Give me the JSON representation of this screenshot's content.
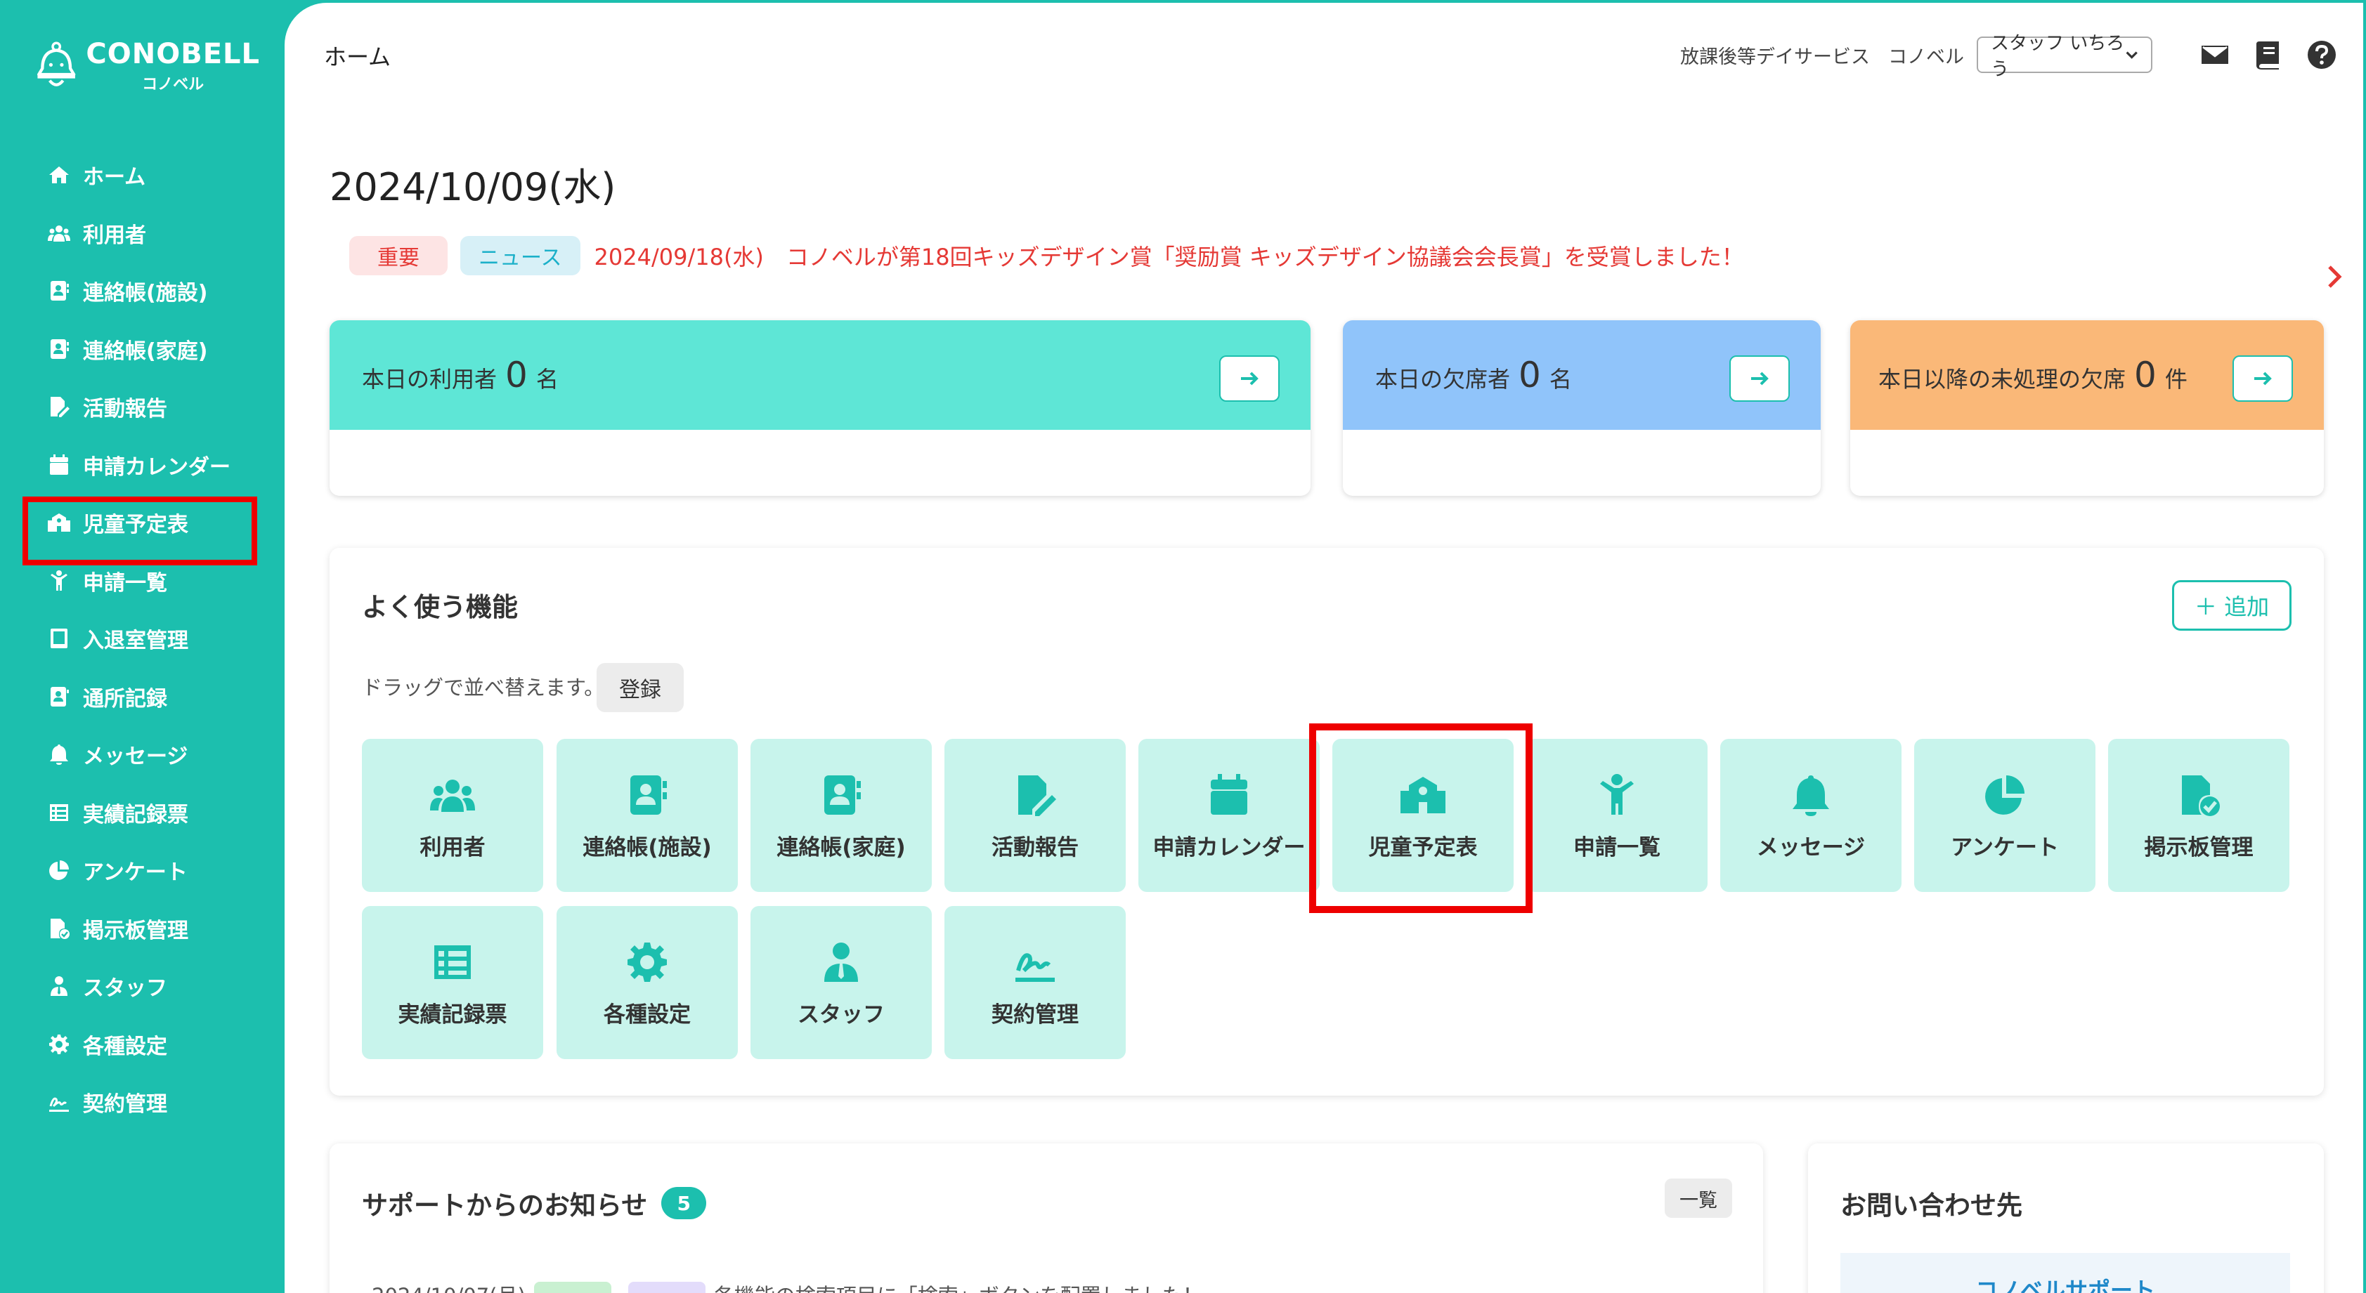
{
  "brand": {
    "name": "CONOBELL",
    "sub": "コノベル"
  },
  "colors": {
    "accent": "#1cbfae",
    "danger": "#e53935",
    "tile_bg": "#c8f4ec",
    "highlight_box": "#ee0000"
  },
  "sidebar": {
    "items": [
      {
        "label": "ホーム",
        "icon": "home-icon"
      },
      {
        "label": "利用者",
        "icon": "users-icon"
      },
      {
        "label": "連絡帳(施設)",
        "icon": "contact-book-icon"
      },
      {
        "label": "連絡帳(家庭)",
        "icon": "contact-book-icon"
      },
      {
        "label": "活動報告",
        "icon": "file-edit-icon"
      },
      {
        "label": "申請カレンダー",
        "icon": "calendar-icon"
      },
      {
        "label": "児童予定表",
        "icon": "school-icon"
      },
      {
        "label": "申請一覧",
        "icon": "child-icon"
      },
      {
        "label": "入退室管理",
        "icon": "tablet-icon"
      },
      {
        "label": "通所記録",
        "icon": "id-card-icon"
      },
      {
        "label": "メッセージ",
        "icon": "bell-icon"
      },
      {
        "label": "実績記録票",
        "icon": "table-icon"
      },
      {
        "label": "アンケート",
        "icon": "pie-chart-icon"
      },
      {
        "label": "掲示板管理",
        "icon": "file-check-icon"
      },
      {
        "label": "スタッフ",
        "icon": "staff-icon"
      },
      {
        "label": "各種設定",
        "icon": "gear-icon"
      },
      {
        "label": "契約管理",
        "icon": "signature-icon"
      }
    ]
  },
  "header": {
    "breadcrumb": "ホーム",
    "facility": "放課後等デイサービス",
    "org": "コノベル",
    "staff_select": "スタッフ いちろう"
  },
  "date": "2024/10/09(水)",
  "news": {
    "badge_important": "重要",
    "badge_news": "ニュース",
    "text": "2024/09/18(水)　コノベルが第18回キッズデザイン賞「奨励賞 キッズデザイン協議会会長賞」を受賞しました！"
  },
  "stats": [
    {
      "label_pre": "本日の利用者",
      "value": "0",
      "unit": "名",
      "color": "#5ee6d6"
    },
    {
      "label_pre": "本日の欠席者",
      "value": "0",
      "unit": "名",
      "color": "#90c4fa"
    },
    {
      "label_pre": "本日以降の未処理の欠席",
      "value": "0",
      "unit": "件",
      "color": "#fab878"
    }
  ],
  "favorites": {
    "title": "よく使う機能",
    "add_label": "＋ 追加",
    "drag_hint": "ドラッグで並べ替えます。",
    "register_label": "登録",
    "tiles": [
      {
        "label": "利用者",
        "icon": "users-icon"
      },
      {
        "label": "連絡帳(施設)",
        "icon": "contact-book-icon"
      },
      {
        "label": "連絡帳(家庭)",
        "icon": "contact-book-icon"
      },
      {
        "label": "活動報告",
        "icon": "file-edit-icon"
      },
      {
        "label": "申請カレンダー",
        "icon": "calendar-icon"
      },
      {
        "label": "児童予定表",
        "icon": "school-icon"
      },
      {
        "label": "申請一覧",
        "icon": "child-icon"
      },
      {
        "label": "メッセージ",
        "icon": "bell-icon"
      },
      {
        "label": "アンケート",
        "icon": "pie-chart-icon"
      },
      {
        "label": "掲示板管理",
        "icon": "file-check-icon"
      },
      {
        "label": "実績記録票",
        "icon": "table-icon"
      },
      {
        "label": "各種設定",
        "icon": "gear-icon"
      },
      {
        "label": "スタッフ",
        "icon": "staff-icon"
      },
      {
        "label": "契約管理",
        "icon": "signature-icon"
      }
    ]
  },
  "support": {
    "title": "サポートからのお知らせ",
    "count": "5",
    "list_label": "一覧",
    "row_date": "2024/10/07(月)",
    "row_text": "各機能の検索項目に「検索」ボタンを配置しました！"
  },
  "contact": {
    "title": "お問い合わせ先",
    "link": "コノベルサポート"
  }
}
